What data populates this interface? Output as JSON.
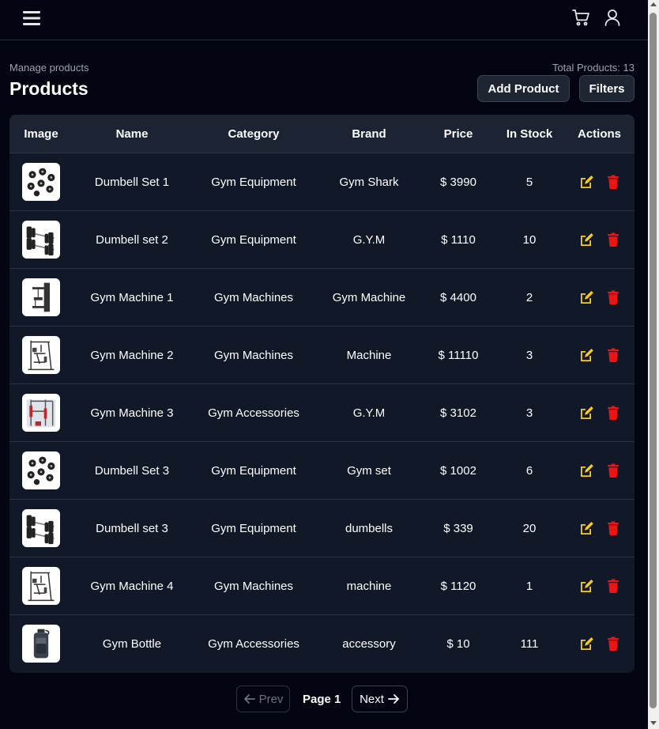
{
  "header": {
    "menu_icon": "hamburger-menu-icon",
    "cart_icon": "shopping-cart-icon",
    "user_icon": "user-icon"
  },
  "page": {
    "subtitle": "Manage products",
    "title": "Products",
    "total_label": "Total Products: 13",
    "add_button": "Add Product",
    "filters_button": "Filters"
  },
  "table": {
    "columns": [
      "Image",
      "Name",
      "Category",
      "Brand",
      "Price",
      "In Stock",
      "Actions"
    ],
    "rows": [
      {
        "image": "dumbbell-set-image",
        "name": "Dumbell Set 1",
        "category": "Gym Equipment",
        "brand": "Gym Shark",
        "price": "$ 3990",
        "stock": "5"
      },
      {
        "image": "dumbbell-pair-image",
        "name": "Dumbell set 2",
        "category": "Gym Equipment",
        "brand": "G.Y.M",
        "price": "$ 1110",
        "stock": "10"
      },
      {
        "image": "gym-machine-image",
        "name": "Gym Machine 1",
        "category": "Gym Machines",
        "brand": "Gym Machine",
        "price": "$ 4400",
        "stock": "2"
      },
      {
        "image": "home-gym-image",
        "name": "Gym Machine 2",
        "category": "Gym Machines",
        "brand": "Machine",
        "price": "$ 11110",
        "stock": "3"
      },
      {
        "image": "power-rack-image",
        "name": "Gym Machine 3",
        "category": "Gym Accessories",
        "brand": "G.Y.M",
        "price": "$ 3102",
        "stock": "3"
      },
      {
        "image": "dumbbell-set-image",
        "name": "Dumbell Set 3",
        "category": "Gym Equipment",
        "brand": "Gym set",
        "price": "$ 1002",
        "stock": "6"
      },
      {
        "image": "dumbbell-pair-image",
        "name": "Dumbell set 3",
        "category": "Gym Equipment",
        "brand": "dumbells",
        "price": "$ 339",
        "stock": "20"
      },
      {
        "image": "home-gym-image",
        "name": "Gym Machine 4",
        "category": "Gym Machines",
        "brand": "machine",
        "price": "$ 1120",
        "stock": "1"
      },
      {
        "image": "water-bottle-image",
        "name": "Gym Bottle",
        "category": "Gym Accessories",
        "brand": "accessory",
        "price": "$ 10",
        "stock": "111"
      }
    ],
    "edit_icon": "edit-icon",
    "delete_icon": "trash-icon",
    "edit_color": "#facc15",
    "delete_color": "#ef1313"
  },
  "pagination": {
    "prev_label": "Prev",
    "page_label": "Page 1",
    "next_label": "Next"
  }
}
